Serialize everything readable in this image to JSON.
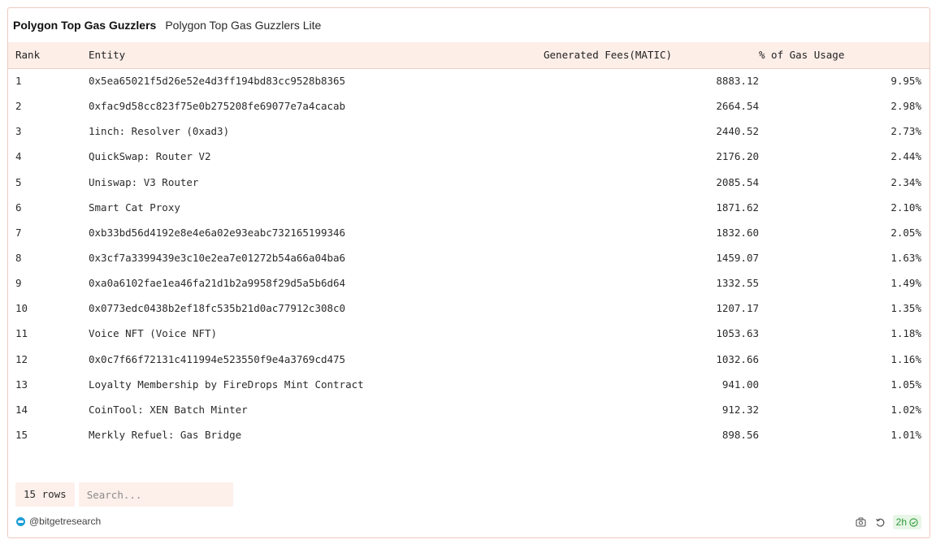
{
  "title": {
    "main": "Polygon Top Gas Guzzlers",
    "sub": "Polygon Top Gas Guzzlers Lite"
  },
  "columns": [
    "Rank",
    "Entity",
    "Generated Fees(MATIC)",
    "% of Gas Usage"
  ],
  "rows": [
    {
      "rank": "1",
      "entity": "0x5ea65021f5d26e52e4d3ff194bd83cc9528b8365",
      "fees": "8883.12",
      "pct": "9.95%"
    },
    {
      "rank": "2",
      "entity": "0xfac9d58cc823f75e0b275208fe69077e7a4cacab",
      "fees": "2664.54",
      "pct": "2.98%"
    },
    {
      "rank": "3",
      "entity": "1inch: Resolver (0xad3)",
      "fees": "2440.52",
      "pct": "2.73%"
    },
    {
      "rank": "4",
      "entity": "QuickSwap: Router V2",
      "fees": "2176.20",
      "pct": "2.44%"
    },
    {
      "rank": "5",
      "entity": "Uniswap: V3 Router",
      "fees": "2085.54",
      "pct": "2.34%"
    },
    {
      "rank": "6",
      "entity": "Smart Cat Proxy",
      "fees": "1871.62",
      "pct": "2.10%"
    },
    {
      "rank": "7",
      "entity": "0xb33bd56d4192e8e4e6a02e93eabc732165199346",
      "fees": "1832.60",
      "pct": "2.05%"
    },
    {
      "rank": "8",
      "entity": "0x3cf7a3399439e3c10e2ea7e01272b54a66a04ba6",
      "fees": "1459.07",
      "pct": "1.63%"
    },
    {
      "rank": "9",
      "entity": "0xa0a6102fae1ea46fa21d1b2a9958f29d5a5b6d64",
      "fees": "1332.55",
      "pct": "1.49%"
    },
    {
      "rank": "10",
      "entity": "0x0773edc0438b2ef18fc535b21d0ac77912c308c0",
      "fees": "1207.17",
      "pct": "1.35%"
    },
    {
      "rank": "11",
      "entity": "Voice NFT (Voice NFT)",
      "fees": "1053.63",
      "pct": "1.18%"
    },
    {
      "rank": "12",
      "entity": "0x0c7f66f72131c411994e523550f9e4a3769cd475",
      "fees": "1032.66",
      "pct": "1.16%"
    },
    {
      "rank": "13",
      "entity": "Loyalty Membership by FireDrops Mint Contract",
      "fees": "941.00",
      "pct": "1.05%"
    },
    {
      "rank": "14",
      "entity": "CoinTool: XEN Batch Minter",
      "fees": "912.32",
      "pct": "1.02%"
    },
    {
      "rank": "15",
      "entity": "Merkly Refuel: Gas Bridge",
      "fees": "898.56",
      "pct": "1.01%"
    }
  ],
  "footer": {
    "row_count": "15 rows",
    "search_placeholder": "Search...",
    "attribution": "@bitgetresearch",
    "age": "2h"
  },
  "icons": {
    "camera": "camera-icon",
    "refresh": "refresh-icon",
    "check": "check-circle-icon",
    "avatar": "avatar-icon"
  },
  "colors": {
    "header_bg": "#fdeee8",
    "card_border": "#f0c9bd",
    "status_green": "#2f9a3a",
    "avatar_blue": "#1e9ed6"
  }
}
